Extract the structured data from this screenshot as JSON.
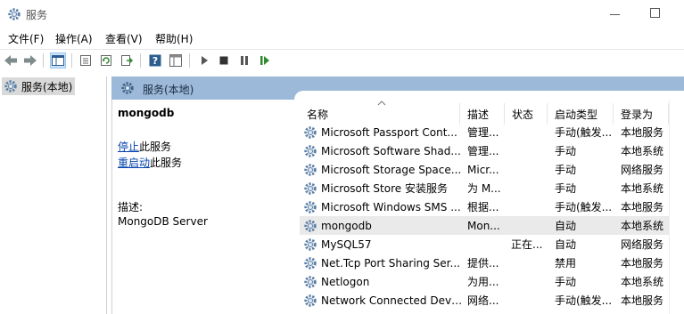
{
  "window": {
    "title": "服务"
  },
  "menu": [
    "文件(F)",
    "操作(A)",
    "查看(V)",
    "帮助(H)"
  ],
  "tree": {
    "root_label": "服务(本地)"
  },
  "right_header": {
    "label": "服务(本地)"
  },
  "details": {
    "service_name": "mongodb",
    "stop_link": "停止",
    "stop_suffix": "此服务",
    "restart_link": "重启动",
    "restart_suffix": "此服务",
    "description_label": "描述:",
    "description_text": "MongoDB Server"
  },
  "table": {
    "columns": [
      "名称",
      "描述",
      "状态",
      "启动类型",
      "登录为"
    ],
    "rows": [
      {
        "name": "Microsoft Passport Cont...",
        "desc": "管理...",
        "status": "",
        "startup": "手动(触发...",
        "logon": "本地服务"
      },
      {
        "name": "Microsoft Software Shad...",
        "desc": "管理...",
        "status": "",
        "startup": "手动",
        "logon": "本地系统"
      },
      {
        "name": "Microsoft Storage Space...",
        "desc": "Micr...",
        "status": "",
        "startup": "手动",
        "logon": "网络服务"
      },
      {
        "name": "Microsoft Store 安装服务",
        "desc": "为 M...",
        "status": "",
        "startup": "手动",
        "logon": "本地系统"
      },
      {
        "name": "Microsoft Windows SMS ...",
        "desc": "根据...",
        "status": "",
        "startup": "手动(触发...",
        "logon": "本地服务"
      },
      {
        "name": "mongodb",
        "desc": "Mon...",
        "status": "",
        "startup": "自动",
        "logon": "本地系统",
        "selected": true
      },
      {
        "name": "MySQL57",
        "desc": "",
        "status": "正在...",
        "startup": "自动",
        "logon": "网络服务"
      },
      {
        "name": "Net.Tcp Port Sharing Ser...",
        "desc": "提供...",
        "status": "",
        "startup": "禁用",
        "logon": "本地服务"
      },
      {
        "name": "Netlogon",
        "desc": "为用...",
        "status": "",
        "startup": "手动",
        "logon": "本地系统"
      },
      {
        "name": "Network Connected Devi...",
        "desc": "网络...",
        "status": "",
        "startup": "手动(触发...",
        "logon": "本地服务"
      }
    ]
  }
}
